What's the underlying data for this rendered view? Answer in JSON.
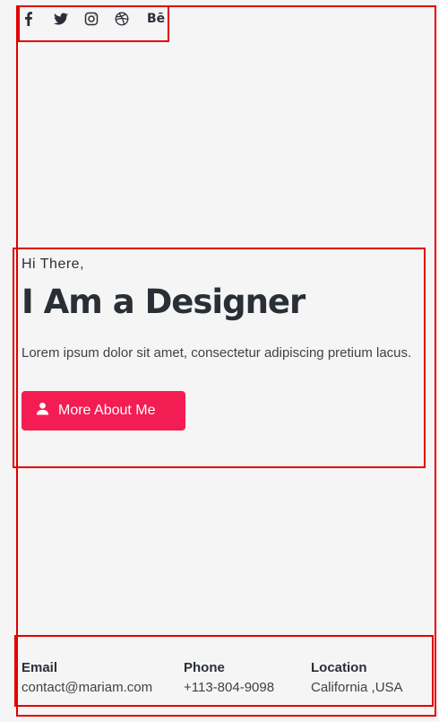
{
  "social": {
    "items": [
      {
        "name": "facebook",
        "icon": "facebook-icon"
      },
      {
        "name": "twitter",
        "icon": "twitter-icon"
      },
      {
        "name": "instagram",
        "icon": "instagram-icon"
      },
      {
        "name": "dribbble",
        "icon": "dribbble-icon"
      },
      {
        "name": "behance",
        "icon": "behance-icon",
        "text": "Bē"
      }
    ]
  },
  "hero": {
    "greeting": "Hi There,",
    "headline": "I Am a Designer",
    "description": "Lorem ipsum dolor sit amet, consectetur adipiscing pretium lacus.",
    "cta_label": "More About Me",
    "cta_icon": "user-icon"
  },
  "contact": {
    "email_label": "Email",
    "email_value": "contact@mariam.com",
    "phone_label": "Phone",
    "phone_value": "+113-804-9098",
    "location_label": "Location",
    "location_value": "California ,USA"
  },
  "colors": {
    "accent": "#f41d53",
    "text_dark": "#2a2f36",
    "background": "#f5f5f5",
    "highlight_frame": "#e30000"
  }
}
